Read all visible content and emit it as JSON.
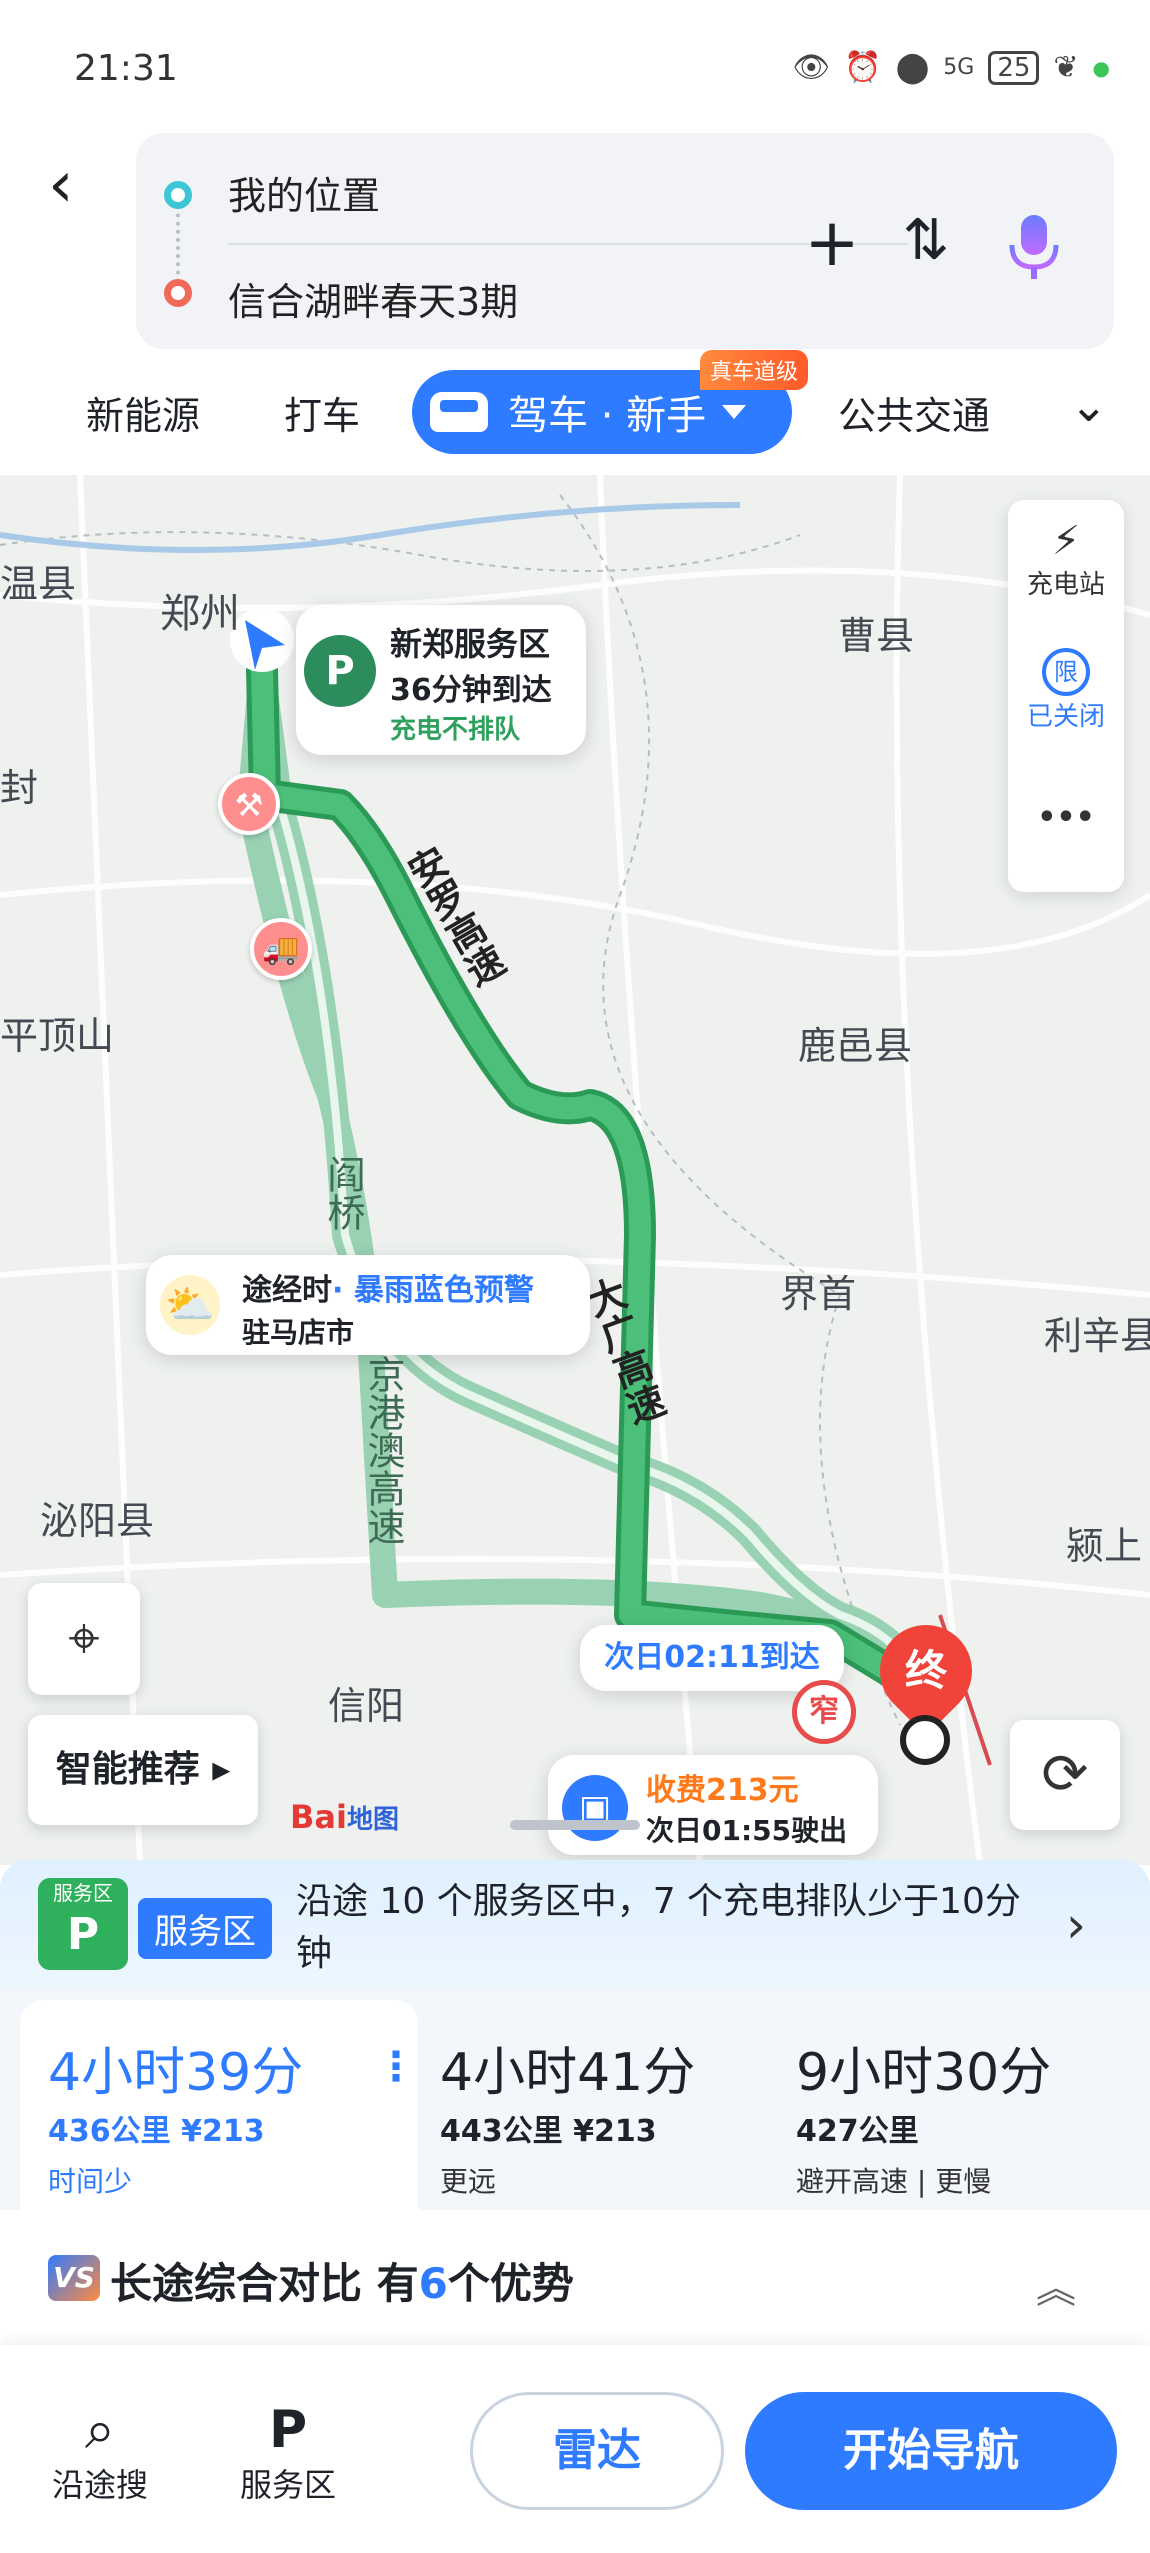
{
  "status": {
    "time": "21:31",
    "battery": "25",
    "signal": "5G"
  },
  "route": {
    "from": "我的位置",
    "to": "信合湖畔春天3期"
  },
  "tabs": {
    "t1": "新能源",
    "t2": "打车",
    "active": "驾车 · 新手",
    "badge": "真车道级",
    "t4": "公共交通"
  },
  "map": {
    "cities": {
      "zhengzhou": "郑州",
      "caoxian": "曹县",
      "pingdingshan": "平顶山",
      "luyi": "鹿邑县",
      "jieshou": "界首",
      "lixin": "利辛县",
      "biyang": "泌阳县",
      "xinyang": "信阳",
      "yingshang": "颍上",
      "wenxian": "温县",
      "kaifeng": "封"
    },
    "roads": {
      "r1": "安罗高速",
      "r2": "大广高速",
      "r3": "京港澳高速",
      "r4": "阎桥"
    },
    "side_panel": {
      "charge": "充电站",
      "limit": "限",
      "limit_state": "已关闭",
      "more": "•••"
    },
    "stop_bubble": {
      "title": "新郑服务区",
      "eta": "36分钟到达",
      "note": "充电不排队"
    },
    "weather_bubble": {
      "label": "途经时",
      "alert": "· 暴雨蓝色预警",
      "place": "驻马店市"
    },
    "arrive_bubble": "次日02:11到达",
    "toll_bubble": {
      "fee": "收费213元",
      "exit": "次日01:55驶出"
    },
    "end_marker": "终",
    "narrow_marker": "窄",
    "smart_button": "智能推荐 ▸",
    "logo": "Bai",
    "logo2": "地图"
  },
  "service": {
    "badge": "服务区",
    "icon_top": "服务区",
    "text": "沿途 10 个服务区中，7 个充电排队少于10分钟"
  },
  "routes": [
    {
      "time": "4小时39分",
      "dist": "436公里  ¥213",
      "note": "时间少"
    },
    {
      "time": "4小时41分",
      "dist": "443公里  ¥213",
      "note": "更远"
    },
    {
      "time": "9小时30分",
      "dist": "427公里",
      "note": "避开高速 | 更慢"
    }
  ],
  "compare": {
    "prefix": "长途综合对比 有",
    "count": "6",
    "suffix": "个优势",
    "vs": "VS"
  },
  "bottom": {
    "search": "沿途搜",
    "service": "服务区",
    "radar": "雷达",
    "start": "开始导航"
  },
  "colors": {
    "accent": "#2f7bff",
    "route_main": "#39b36a",
    "route_alt": "#8fcfac"
  }
}
